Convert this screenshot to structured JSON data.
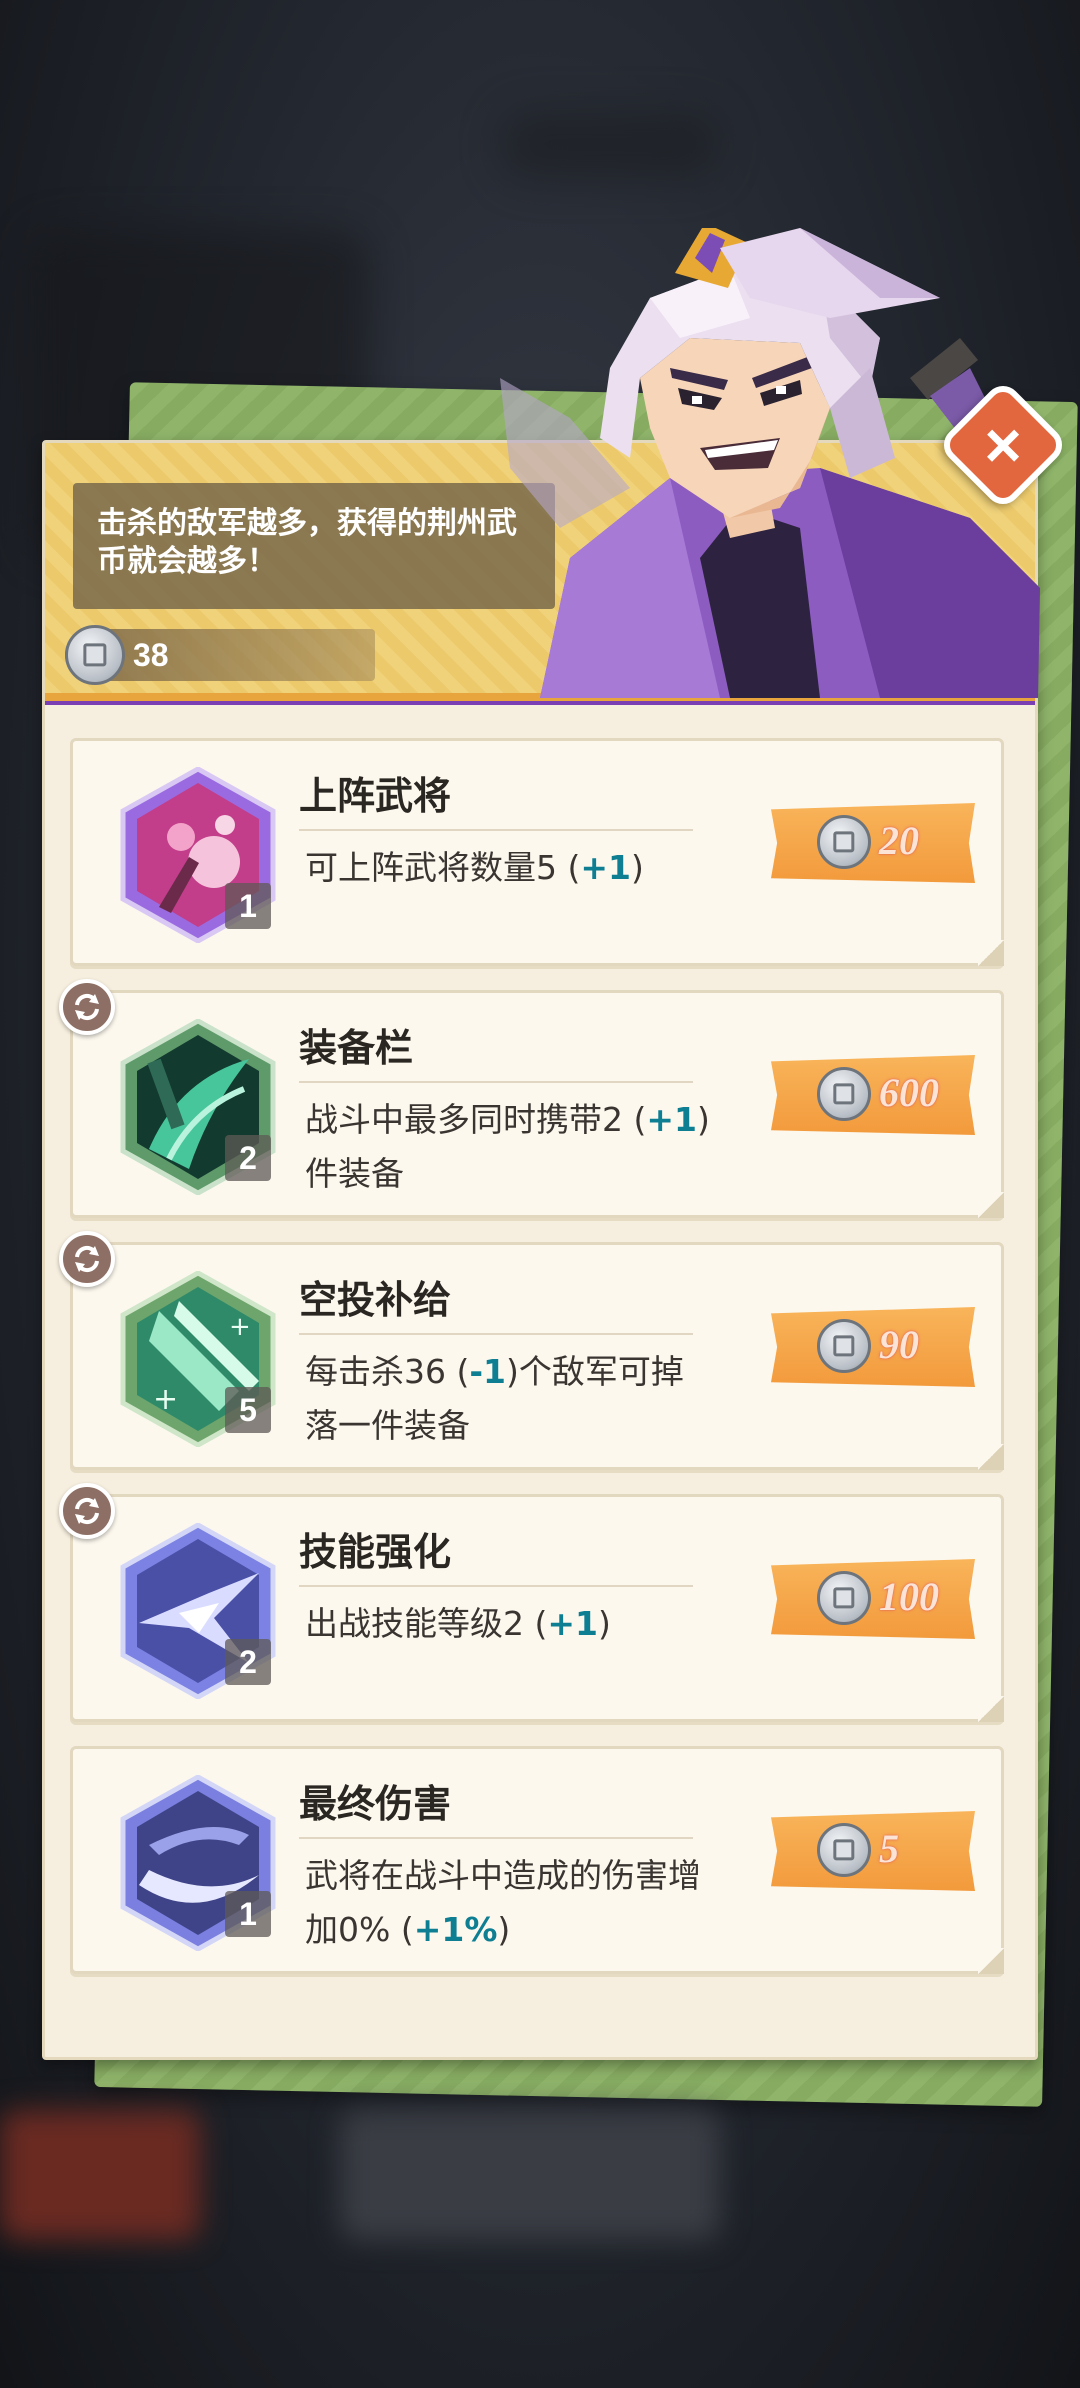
{
  "header": {
    "message": "击杀的敌军越多，获得的荆州武币就会越多！",
    "coin_count": "38"
  },
  "close_icon": "×",
  "upgrades": [
    {
      "title": "上阵武将",
      "level": "1",
      "desc_pre": "可上阵武将数量5 (",
      "desc_hl": "+1",
      "desc_post": ")",
      "price": "20",
      "icon": "cherry-blossom-skill-icon",
      "has_refresh": false
    },
    {
      "title": "装备栏",
      "level": "2",
      "desc_pre": "战斗中最多同时携带2 (",
      "desc_hl": "+1",
      "desc_post": ")件装备",
      "price": "600",
      "icon": "equipment-slot-skill-icon",
      "has_refresh": true
    },
    {
      "title": "空投补给",
      "level": "5",
      "desc_pre": "每击杀36 (",
      "desc_hl": "-1",
      "desc_post": ")个敌军可掉落一件装备",
      "price": "90",
      "icon": "airdrop-skill-icon",
      "has_refresh": true
    },
    {
      "title": "技能强化",
      "level": "2",
      "desc_pre": "出战技能等级2 (",
      "desc_hl": "+1",
      "desc_post": ")",
      "price": "100",
      "icon": "skill-boost-icon",
      "has_refresh": true
    },
    {
      "title": "最终伤害",
      "level": "1",
      "desc_pre": "武将在战斗中造成的伤害增加0% (",
      "desc_hl": "+1%",
      "desc_post": ")",
      "price": "5",
      "icon": "final-damage-icon",
      "has_refresh": false
    }
  ],
  "colors": {
    "panel": "#f6efdf",
    "header": "#f0d27a",
    "price_tag": "#f6a84a",
    "highlight": "#0e7e93",
    "close": "#e2673f"
  }
}
